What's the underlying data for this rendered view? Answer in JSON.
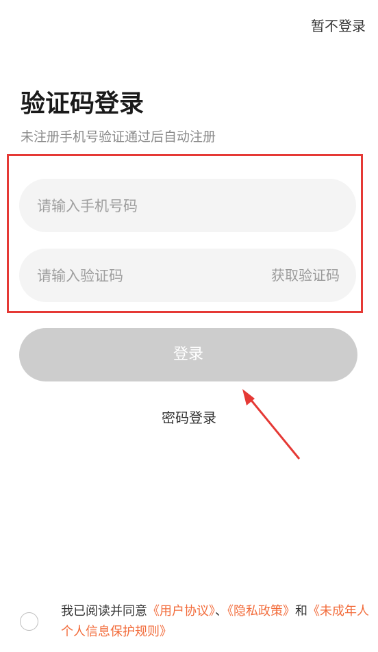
{
  "header": {
    "skip_label": "暂不登录"
  },
  "title": "验证码登录",
  "subtitle": "未注册手机号验证通过后自动注册",
  "phone_field": {
    "placeholder": "请输入手机号码"
  },
  "code_field": {
    "placeholder": "请输入验证码",
    "get_code_label": "获取验证码"
  },
  "login_button": {
    "label": "登录"
  },
  "password_login": {
    "label": "密码登录"
  },
  "agreement": {
    "prefix": "我已阅读并同意",
    "user_agreement": "《用户协议》",
    "separator": "、",
    "privacy_policy": "《隐私政策》",
    "and": "和",
    "minor_rules": "《未成年人个人信息保护规则》"
  },
  "colors": {
    "highlight": "#e53935",
    "link": "#f26b3a",
    "button_disabled": "#cdcdcd"
  }
}
